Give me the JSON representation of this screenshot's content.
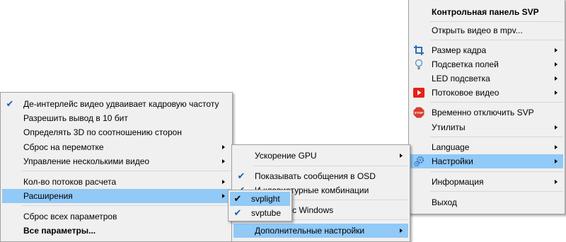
{
  "main_menu": {
    "header": "Контрольная панель SVP",
    "items": [
      {
        "label": "Открыть видео в mpv...",
        "icon": null,
        "submenu": false
      },
      {
        "label": "Размер кадра",
        "icon": "crop-icon",
        "submenu": true
      },
      {
        "label": "Подсветка полей",
        "icon": "lightbulb-icon",
        "submenu": true
      },
      {
        "label": "LED подсветка",
        "icon": null,
        "submenu": true
      },
      {
        "label": "Потоковое видео",
        "icon": "youtube-icon",
        "submenu": true
      },
      {
        "label": "Временно отключить SVP",
        "icon": "stop-sign-icon",
        "submenu": false
      },
      {
        "label": "Утилиты",
        "icon": null,
        "submenu": true
      },
      {
        "label": "Language",
        "icon": null,
        "submenu": true
      },
      {
        "label": "Настройки",
        "icon": "gears-icon",
        "submenu": true,
        "highlighted": true
      },
      {
        "label": "Информация",
        "icon": null,
        "submenu": true
      },
      {
        "label": "Выход",
        "icon": null,
        "submenu": false
      }
    ],
    "stop_icon_text": "STOP"
  },
  "settings_menu": {
    "items": [
      {
        "label": "Де-интерлейс видео удваивает кадровую частоту",
        "checked": true,
        "submenu": false
      },
      {
        "label": "Разрешить вывод в 10 бит",
        "checked": false,
        "submenu": false
      },
      {
        "label": "Определять 3D по соотношению сторон",
        "checked": false,
        "submenu": false
      },
      {
        "label": "Сброс на перемотке",
        "checked": false,
        "submenu": true
      },
      {
        "label": "Управление несколькими видео",
        "checked": false,
        "submenu": true
      },
      {
        "label": "Кол-во потоков расчета",
        "checked": false,
        "submenu": true
      },
      {
        "label": "Расширения",
        "checked": false,
        "submenu": true,
        "highlighted": true
      },
      {
        "label": "Сброс всех параметров",
        "checked": false,
        "submenu": false
      },
      {
        "label": "Все параметры...",
        "checked": false,
        "submenu": false,
        "bold": true
      }
    ]
  },
  "extensions_menu": {
    "items": [
      {
        "label": "Ускорение GPU",
        "checked": false,
        "submenu": true
      },
      {
        "label": "Показывать сообщения в OSD",
        "checked": true,
        "submenu": false
      },
      {
        "label": "Использовать клавиатурные комбинации",
        "visible_text": "И         клавиатурные комбинации",
        "checked": true,
        "submenu": false
      },
      {
        "label": "Запускать вместе с Windows",
        "visible_text": "З          вместе с Windows",
        "checked": false,
        "submenu": false
      },
      {
        "label": "Дополнительные настройки",
        "checked": false,
        "submenu": true,
        "highlighted": true
      }
    ]
  },
  "plugins_menu": {
    "items": [
      {
        "label": "svplight",
        "checked": true,
        "highlighted": true
      },
      {
        "label": "svptube",
        "checked": true,
        "highlighted": false
      }
    ]
  },
  "check_glyph": "✔"
}
